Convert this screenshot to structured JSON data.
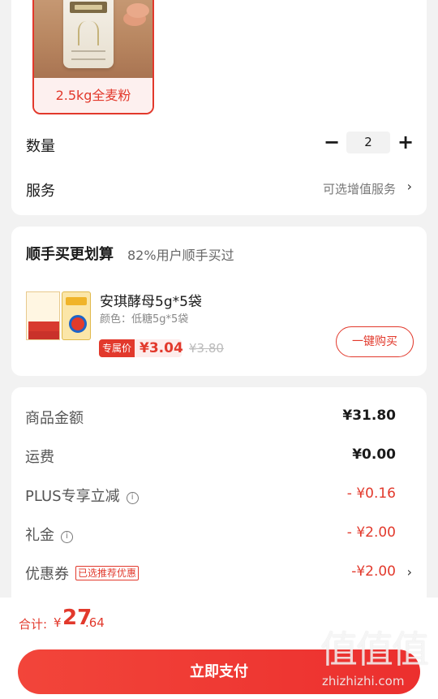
{
  "product_option": {
    "label": "2.5kg全麦粉"
  },
  "quantity": {
    "label": "数量",
    "minus": "−",
    "value": "2",
    "plus": "+"
  },
  "service": {
    "label": "服务",
    "value": "可选增值服务",
    "chevron": "›"
  },
  "bundle": {
    "title": "顺手买更划算",
    "subtitle": "82%用户顺手买过",
    "name": "安琪酵母5g*5袋",
    "color": "颜色：低糖5g*5袋",
    "tag": "专属价",
    "price": "¥3.04",
    "original_price": "¥3.80",
    "button": "一键购买"
  },
  "summary": {
    "items": [
      {
        "label": "商品金额",
        "value": "¥31.80"
      },
      {
        "label": "运费",
        "value": "¥0.00"
      },
      {
        "label": "PLUS专享立减",
        "value": "- ¥0.16"
      },
      {
        "label": "礼金",
        "value": "- ¥2.00"
      },
      {
        "label": "优惠券",
        "badge": "已选推荐优惠",
        "value": "-¥2.00"
      }
    ],
    "chevron": "›",
    "info_glyph": "i"
  },
  "bottom": {
    "total_label": "合计:",
    "total_yen": "¥",
    "total_int": "27",
    "total_dec": ".64",
    "pay_button": "立即支付"
  },
  "watermark": {
    "glyphs": "值值值",
    "url": "zhizhizhi.com"
  },
  "colors": {
    "accent": "#e2392c",
    "background": "#f2f2f2"
  }
}
